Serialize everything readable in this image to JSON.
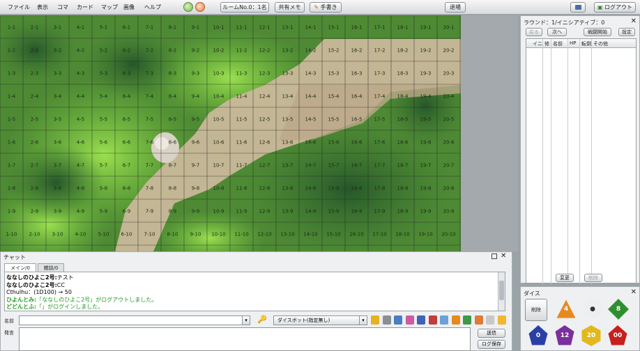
{
  "menubar": {
    "items": [
      "ファイル",
      "表示",
      "コマ",
      "カード",
      "マップ",
      "画像",
      "ヘルプ"
    ],
    "room_label": "ルームNo.0：1名",
    "shared_memo_label": "共有メモ",
    "handout_label": "手書き",
    "leave_label": "退場",
    "logout_label": "ログアウト"
  },
  "map": {
    "columns": 20,
    "rows": 10,
    "cell_label_format": "{col}-{row}",
    "sand_color": "#c9b89a",
    "grass_light": "#7cc23f",
    "grass_dark": "#2f6a2c"
  },
  "initiative": {
    "title": "ラウンド：1/イニシアティブ：0",
    "back_label": "戻る",
    "next_label": "次へ",
    "start_battle_label": "戦闘開始",
    "settings_label": "設定",
    "columns": [
      "イニ",
      "修",
      "名前",
      "HP",
      "転倒",
      "その他"
    ],
    "change_label": "変更",
    "delete_label": "削除"
  },
  "dice": {
    "title": "ダイス",
    "delete_label": "削除",
    "items": [
      {
        "icon": "d4-icon",
        "label": "4",
        "color": "#e8891e"
      },
      {
        "icon": "d6-icon",
        "label": "",
        "color": "#eeeeee"
      },
      {
        "icon": "d8-icon",
        "label": "8",
        "color": "#2f8f2f"
      },
      {
        "icon": "d10-icon",
        "label": "0",
        "color": "#2a3fa6"
      },
      {
        "icon": "d12-icon",
        "label": "12",
        "color": "#7a2f9a"
      },
      {
        "icon": "d20-icon",
        "label": "20",
        "color": "#e2b81f"
      },
      {
        "icon": "d100-icon",
        "label": "00",
        "color": "#c81f1f"
      }
    ]
  },
  "chat": {
    "title": "チャット",
    "tabs": [
      "メイン/0",
      "雑談/0"
    ],
    "messages": [
      {
        "name": "ななしのひよこ2号:",
        "text": "テスト",
        "color": "#000000"
      },
      {
        "name": "ななしのひよこ2号:",
        "text": "CC",
        "color": "#000000"
      },
      {
        "name": "",
        "text": "Cthulhu：(1D100) → 50",
        "color": "#000000"
      },
      {
        "name": "ひよんとみ:",
        "text": "「ななしのひよこ2号」がログアウトしました。",
        "color": "#1f9a1f"
      },
      {
        "name": "どどんとふ:",
        "text": "「」がログインしました。",
        "color": "#1f9a1f"
      }
    ],
    "name_label": "名前",
    "speech_label": "発言",
    "dicebot_value": "ダイスボット(指定無し)",
    "send_label": "送信",
    "log_save_label": "ログ保存"
  }
}
